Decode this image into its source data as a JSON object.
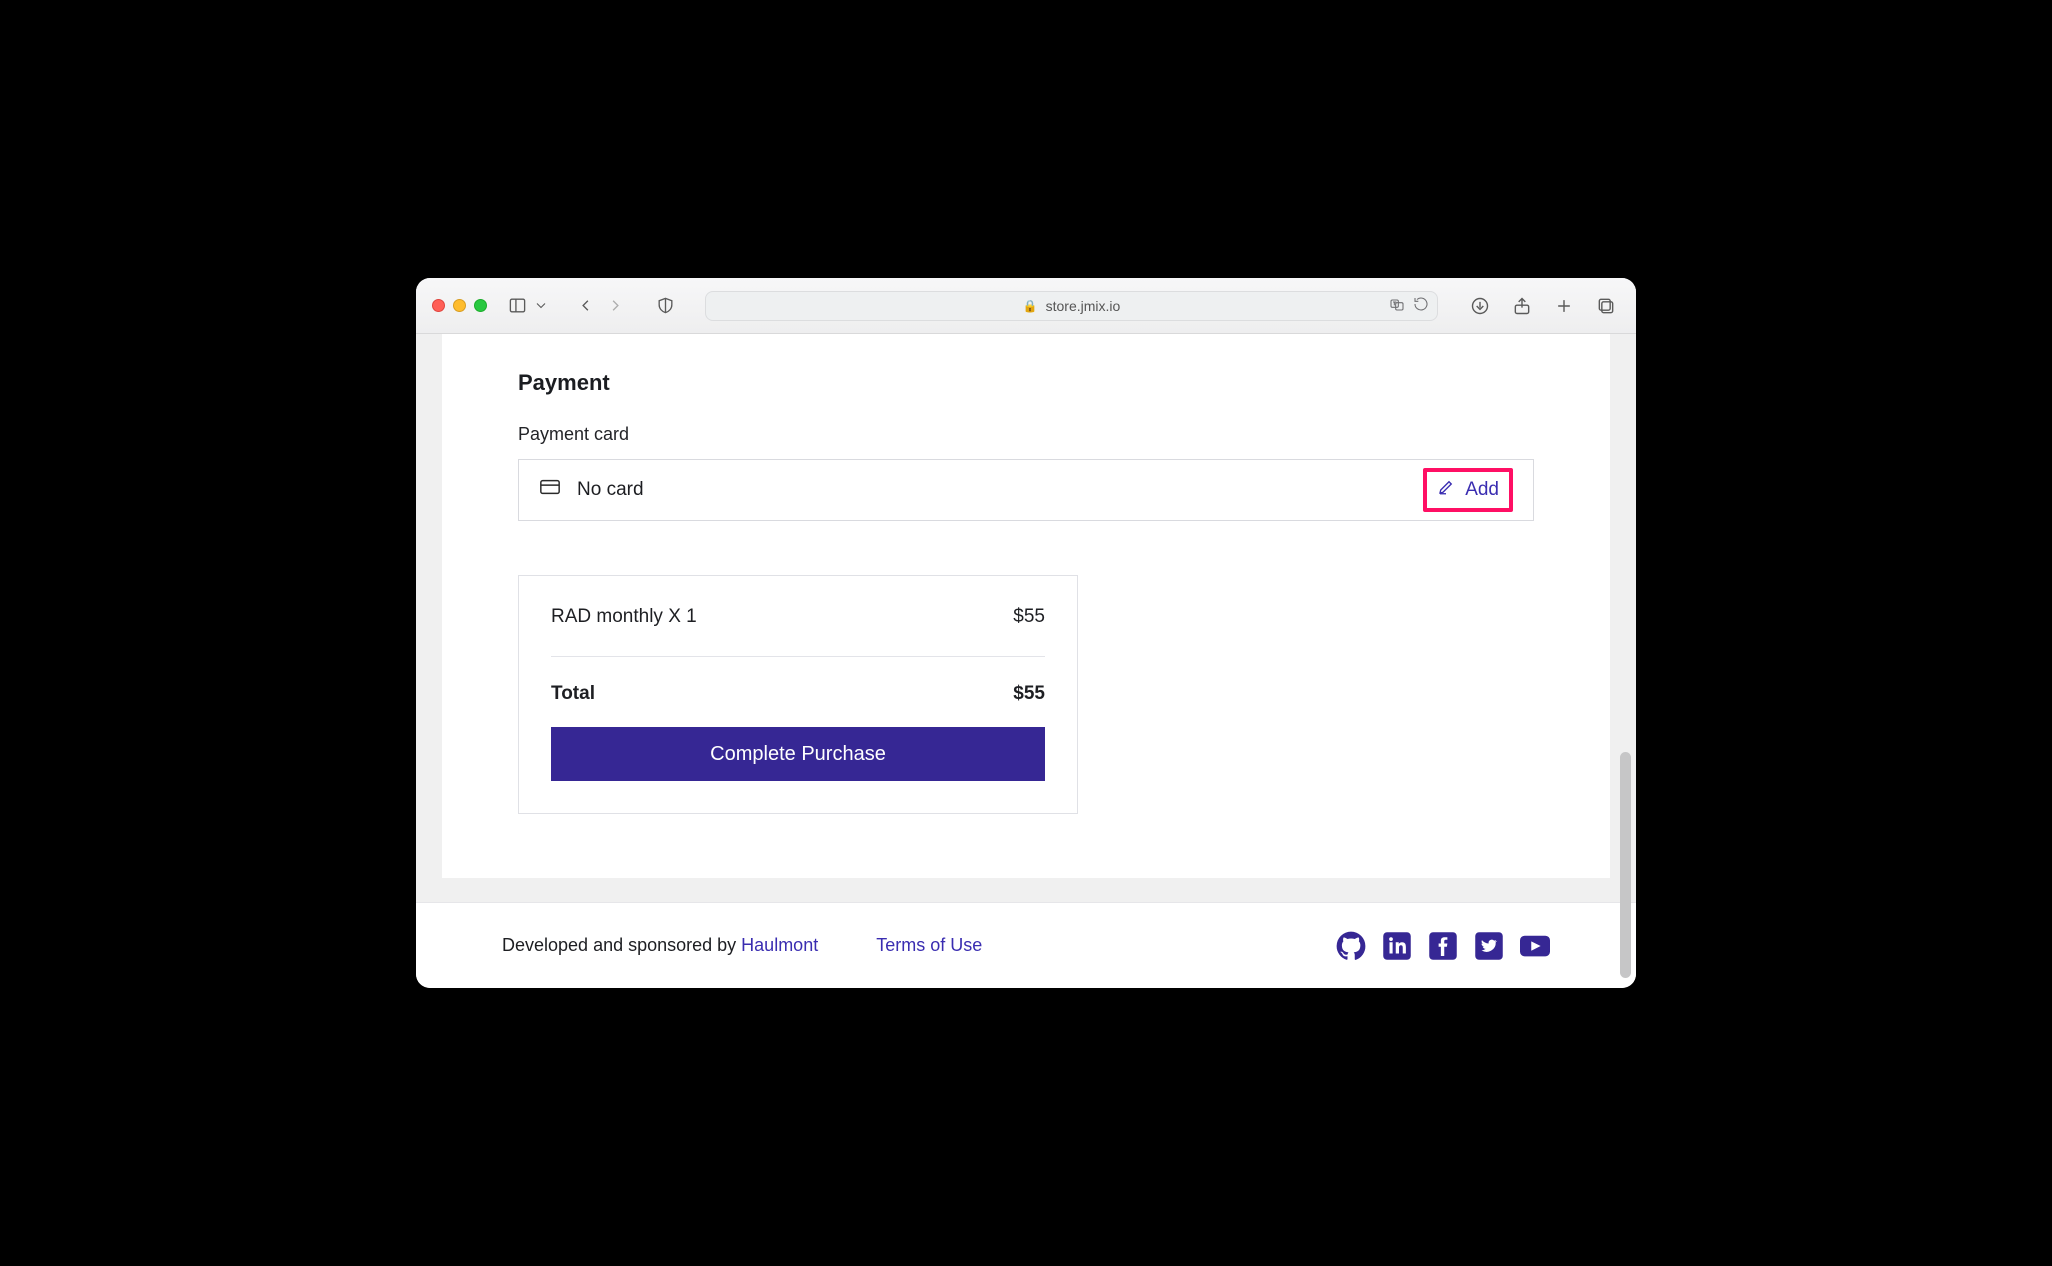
{
  "browser": {
    "url": "store.jmix.io"
  },
  "page": {
    "section_title": "Payment",
    "card_label": "Payment card",
    "card_value": "No card",
    "add_label": "Add",
    "summary": {
      "item_label": "RAD monthly X 1",
      "item_price": "$55",
      "total_label": "Total",
      "total_price": "$55"
    },
    "cta": "Complete Purchase"
  },
  "footer": {
    "sponsor_prefix": "Developed and sponsored by ",
    "sponsor_link": "Haulmont",
    "terms": "Terms of Use"
  }
}
